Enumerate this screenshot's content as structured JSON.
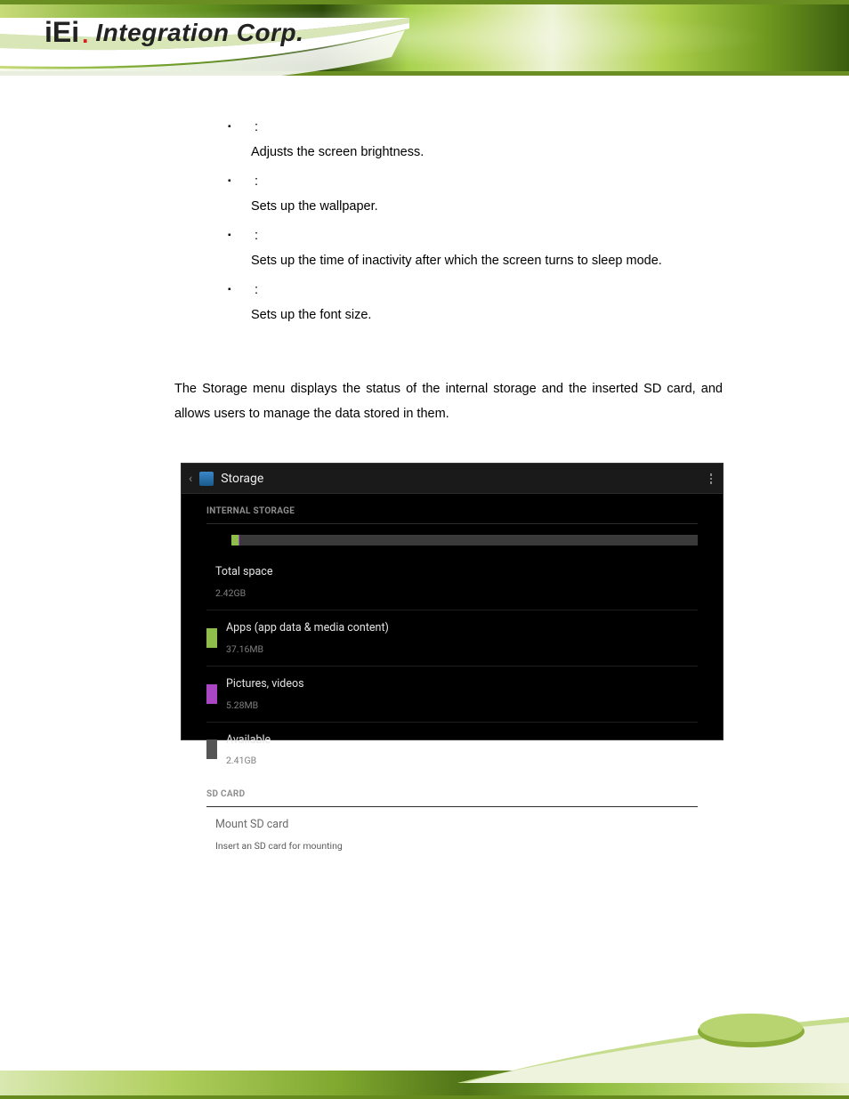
{
  "logo": {
    "mark": "iEi",
    "mark_dot": ".",
    "text": "Integration Corp."
  },
  "bullets": [
    {
      "title": "",
      "colon": ":",
      "desc": "Adjusts the screen brightness."
    },
    {
      "title": "",
      "colon": ":",
      "desc": "Sets up the wallpaper."
    },
    {
      "title": "",
      "colon": ":",
      "desc": "Sets up the time of inactivity after which the screen turns to sleep mode."
    },
    {
      "title": "",
      "colon": ":",
      "desc": "Sets up the font size."
    }
  ],
  "section_paragraph": "The Storage menu displays the status of the internal storage and the inserted SD card, and allows users to manage the data stored in them.",
  "storage": {
    "title": "Storage",
    "sections": {
      "internal_header": "INTERNAL STORAGE",
      "sd_header": "SD CARD"
    },
    "total": {
      "label": "Total space",
      "value": "2.42GB"
    },
    "items": [
      {
        "swatch": "sw-apps",
        "label": "Apps (app data & media content)",
        "value": "37.16MB"
      },
      {
        "swatch": "sw-pics",
        "label": "Pictures, videos",
        "value": "5.28MB"
      },
      {
        "swatch": "sw-avail",
        "label": "Available",
        "value": "2.41GB"
      }
    ],
    "mount": {
      "label": "Mount SD card",
      "sub": "Insert an SD card for mounting"
    }
  }
}
